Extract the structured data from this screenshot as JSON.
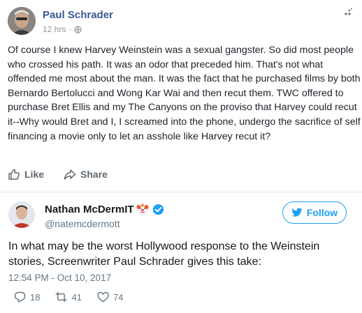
{
  "facebook_post": {
    "author": "Paul Schrader",
    "timestamp": "12 hrs",
    "separator": "·",
    "privacy_icon": "globe-icon",
    "menu_icon": "post-options-icon",
    "body": "Of course I knew Harvey Weinstein was a sexual gangster. So did most people who crossed his path. It was an odor that preceded him. That's not what offended me most about the man. It was the fact that he purchased films by both Bernardo Bertolucci and Wong Kar Wai and then recut them. TWC offered to purchase Bret Ellis and my The Canyons on the proviso that Harvey could recut it--Why would Bret and I, I screamed into the phone, undergo the sacrifice of self financing a movie only to let an asshole like Harvey recut it?",
    "actions": {
      "like_label": "Like",
      "like_icon": "thumbs-up-icon",
      "share_label": "Share",
      "share_icon": "share-arrow-icon"
    },
    "colors": {
      "name": "#385898",
      "text": "#1d2129",
      "meta": "#90949c"
    }
  },
  "tweet": {
    "display_name": "Nathan McDermIT",
    "name_emoji": "clown-face-icon",
    "verified_icon": "verified-badge-icon",
    "handle": "@natemcdermott",
    "follow_label": "Follow",
    "follow_icon": "twitter-bird-icon",
    "text": "In what may be the worst Hollywood response to the Weinstein stories, Screenwriter Paul Schrader gives this take:",
    "time": "12:54 PM - Oct 10, 2017",
    "stats": {
      "replies": "18",
      "retweets": "41",
      "likes": "74"
    },
    "colors": {
      "accent": "#1da1f2",
      "muted": "#657786",
      "text": "#14171a"
    }
  }
}
